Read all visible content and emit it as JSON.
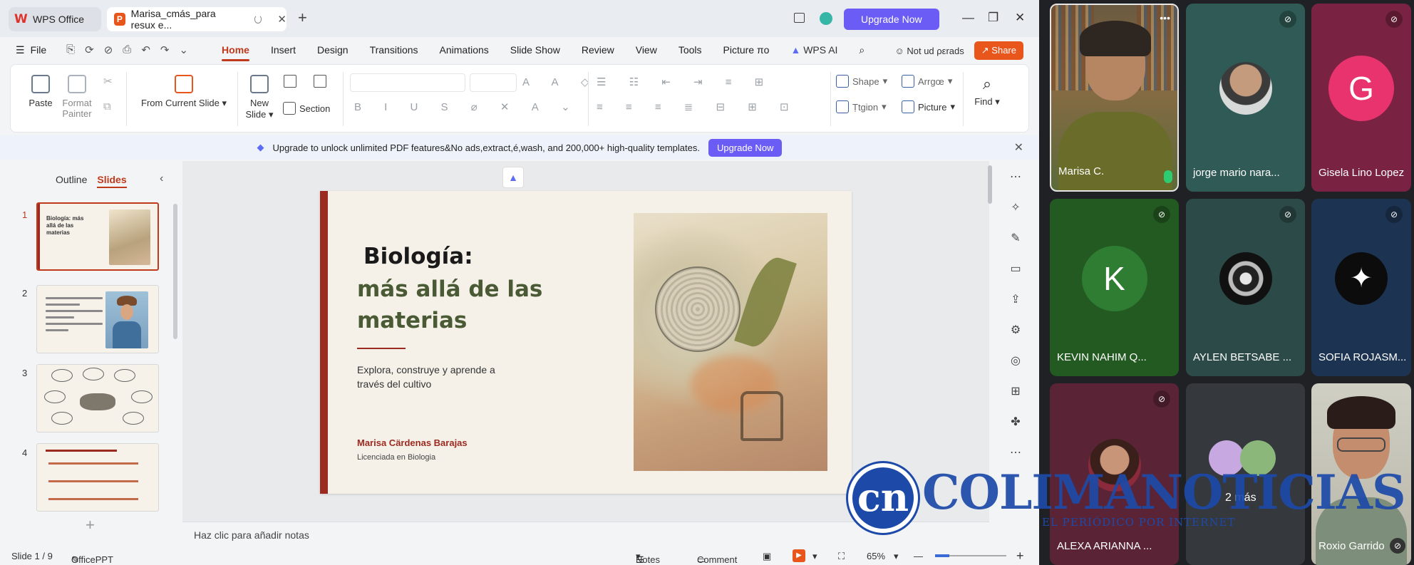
{
  "wps": {
    "app_tab": "WPS Office",
    "doc_tab": "Marisa_cmás_para resux e...",
    "upgrade": "Upgrade Now",
    "menu_file": "File",
    "menu_tabs": [
      "Home",
      "Insert",
      "Design",
      "Transitions",
      "Animations",
      "Slide Show",
      "Review",
      "View",
      "Tools",
      "Picture πo"
    ],
    "ai_tab": "WPS AI",
    "not_uploaded": "Not ud ρεrads",
    "share": "Share"
  },
  "ribbon": {
    "paste": "Paste",
    "format_painter": "Format Painter",
    "from_current": "From Current Slide",
    "new_slide": "New Slide",
    "section": "Section",
    "shape": "Shape",
    "arrange": "Arrɡœ",
    "textbox": "Ṭtɡiɒn",
    "picture": "Picture",
    "find": "Find"
  },
  "banner": {
    "text": "Upgrade to unlock unlimited PDF features&No ads,extract,é,wash, and 200,000+ high-quality templates.",
    "button": "Upgrade Now"
  },
  "pane": {
    "outline": "Outline",
    "slides": "Slides",
    "thumbs": [
      {
        "num": "1",
        "title": "Biología: más allá de las materias"
      },
      {
        "num": "2",
        "title": ""
      },
      {
        "num": "3",
        "title": ""
      },
      {
        "num": "4",
        "title": ""
      }
    ]
  },
  "slide": {
    "title_line1": "Biología:",
    "title_line2": "más allá de las materias",
    "subtitle": "Explora, construye y aprende a través del cultivo",
    "author": "Marisa Cärdenas Barajas",
    "role": "Licenciada en Biologia"
  },
  "notes_placeholder": "Haz clic para añadir notas",
  "status": {
    "slide": "Slide 1 / 9",
    "app": "OfficePPT",
    "notes": "Notes",
    "comment": "Comment",
    "zoom": "65%"
  },
  "meet": {
    "tiles": [
      {
        "name": "Marisa C."
      },
      {
        "name": "jorge mario nara..."
      },
      {
        "name": "Gisela Lino Lopez",
        "initial": "G",
        "color": "#e8336e"
      },
      {
        "name": "KEVIN NAHIM Q...",
        "initial": "K",
        "color": "#2e7d32"
      },
      {
        "name": "AYLEN BETSABE ..."
      },
      {
        "name": "SOFIA ROJASM..."
      },
      {
        "name": "ALEXA ARIANNA ..."
      },
      {
        "name": "2 más"
      },
      {
        "name": "Roxio Garrido"
      }
    ]
  },
  "watermark": {
    "logo": "cn",
    "brand": "COLIMANOTICIAS",
    "tagline": "EL PERIÓDICO POR INTERNET"
  }
}
